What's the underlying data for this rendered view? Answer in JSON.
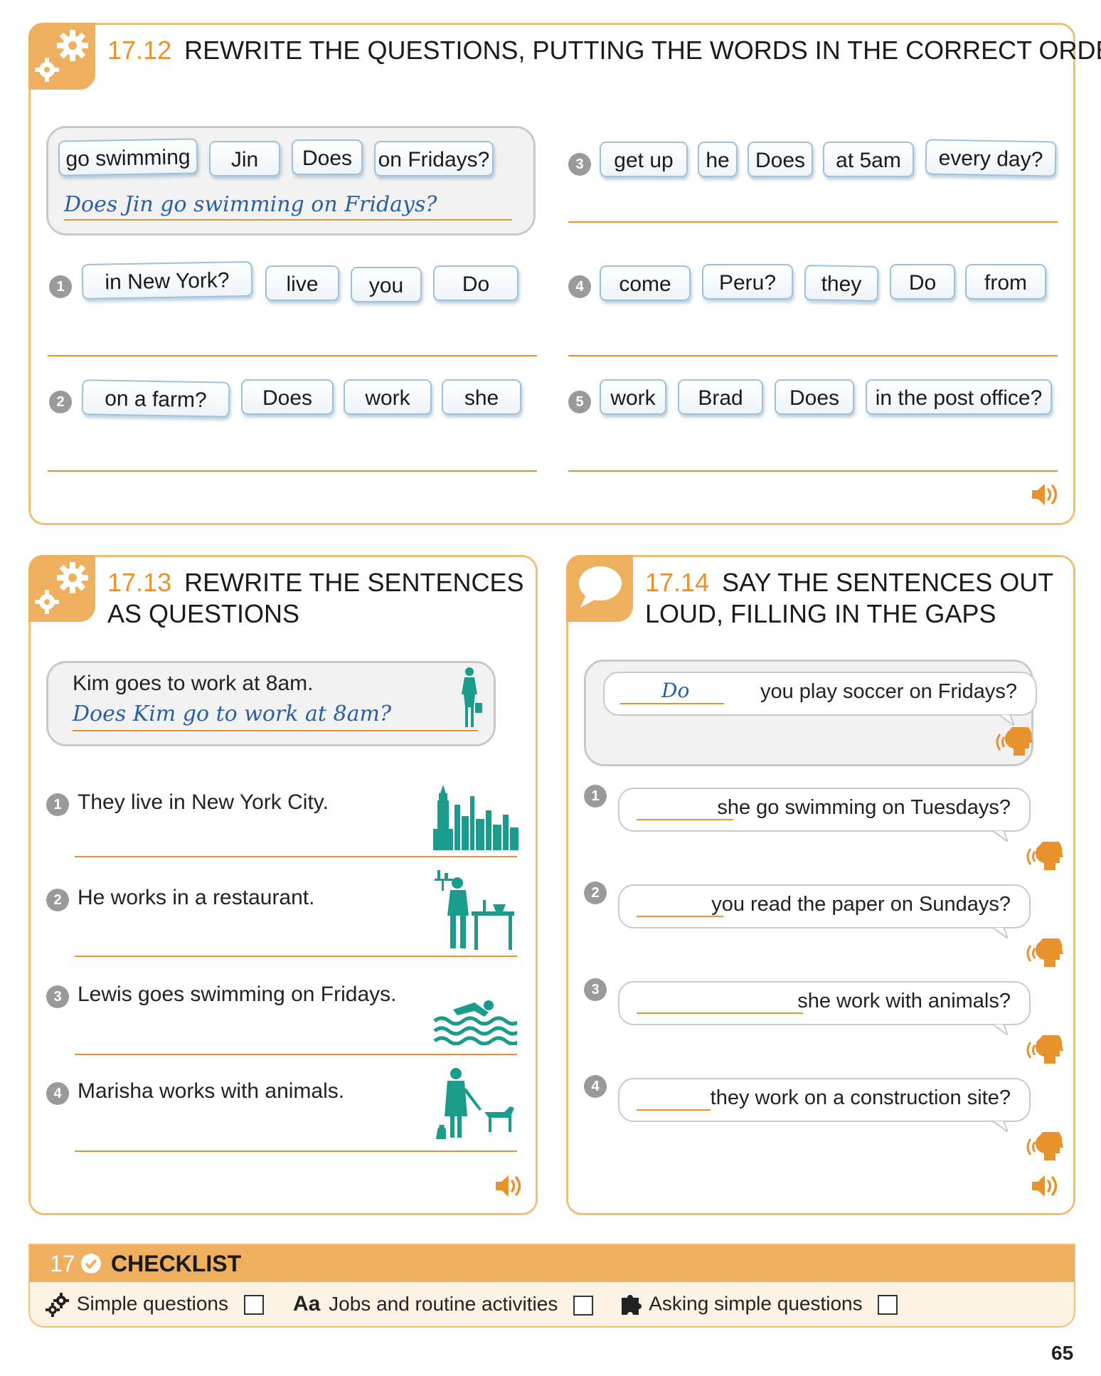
{
  "ex1": {
    "number": "17.12",
    "title": "REWRITE THE QUESTIONS, PUTTING THE WORDS IN THE CORRECT ORDER",
    "example": {
      "words": [
        "go swimming",
        "Jin",
        "Does",
        "on Fridays?"
      ],
      "answer": "Does Jin go swimming on Fridays?"
    },
    "items": [
      {
        "n": "1",
        "words": [
          "in New York?",
          "live",
          "you",
          "Do"
        ]
      },
      {
        "n": "2",
        "words": [
          "on a farm?",
          "Does",
          "work",
          "she"
        ]
      },
      {
        "n": "3",
        "words": [
          "get up",
          "he",
          "Does",
          "at 5am",
          "every day?"
        ]
      },
      {
        "n": "4",
        "words": [
          "come",
          "Peru?",
          "they",
          "Do",
          "from"
        ]
      },
      {
        "n": "5",
        "words": [
          "work",
          "Brad",
          "Does",
          "in the post office?"
        ]
      }
    ]
  },
  "ex2": {
    "number": "17.13",
    "title_line1": "REWRITE THE SENTENCES",
    "title_line2": "AS QUESTIONS",
    "example": {
      "sentence": "Kim goes to work at 8am.",
      "answer": "Does Kim go to work at 8am?"
    },
    "items": [
      {
        "n": "1",
        "text": "They live in New York City."
      },
      {
        "n": "2",
        "text": "He works in a restaurant."
      },
      {
        "n": "3",
        "text": "Lewis goes swimming on Fridays."
      },
      {
        "n": "4",
        "text": "Marisha works with animals."
      }
    ]
  },
  "ex3": {
    "number": "17.14",
    "title_line1": "SAY THE SENTENCES OUT",
    "title_line2": "LOUD, FILLING IN THE GAPS",
    "example": {
      "answer": "Do",
      "text": "you play soccer on Fridays?"
    },
    "items": [
      {
        "n": "1",
        "text": "she go swimming on Tuesdays?"
      },
      {
        "n": "2",
        "text": "you read the paper on Sundays?"
      },
      {
        "n": "3",
        "text": "she work with animals?"
      },
      {
        "n": "4",
        "text": "they work on a construction site?"
      }
    ]
  },
  "checklist": {
    "number": "17",
    "title": "CHECKLIST",
    "items": [
      {
        "icon": "gears-icon",
        "label": "Simple questions"
      },
      {
        "icon": "Aa",
        "label": "Jobs and routine activities"
      },
      {
        "icon": "puzzle-icon",
        "label": "Asking simple questions"
      }
    ]
  },
  "page_number": "65",
  "colors": {
    "accent": "#e8922e",
    "panel_border": "#f0c07a",
    "teal": "#1a9c8c",
    "handwriting": "#2a5ea8"
  }
}
